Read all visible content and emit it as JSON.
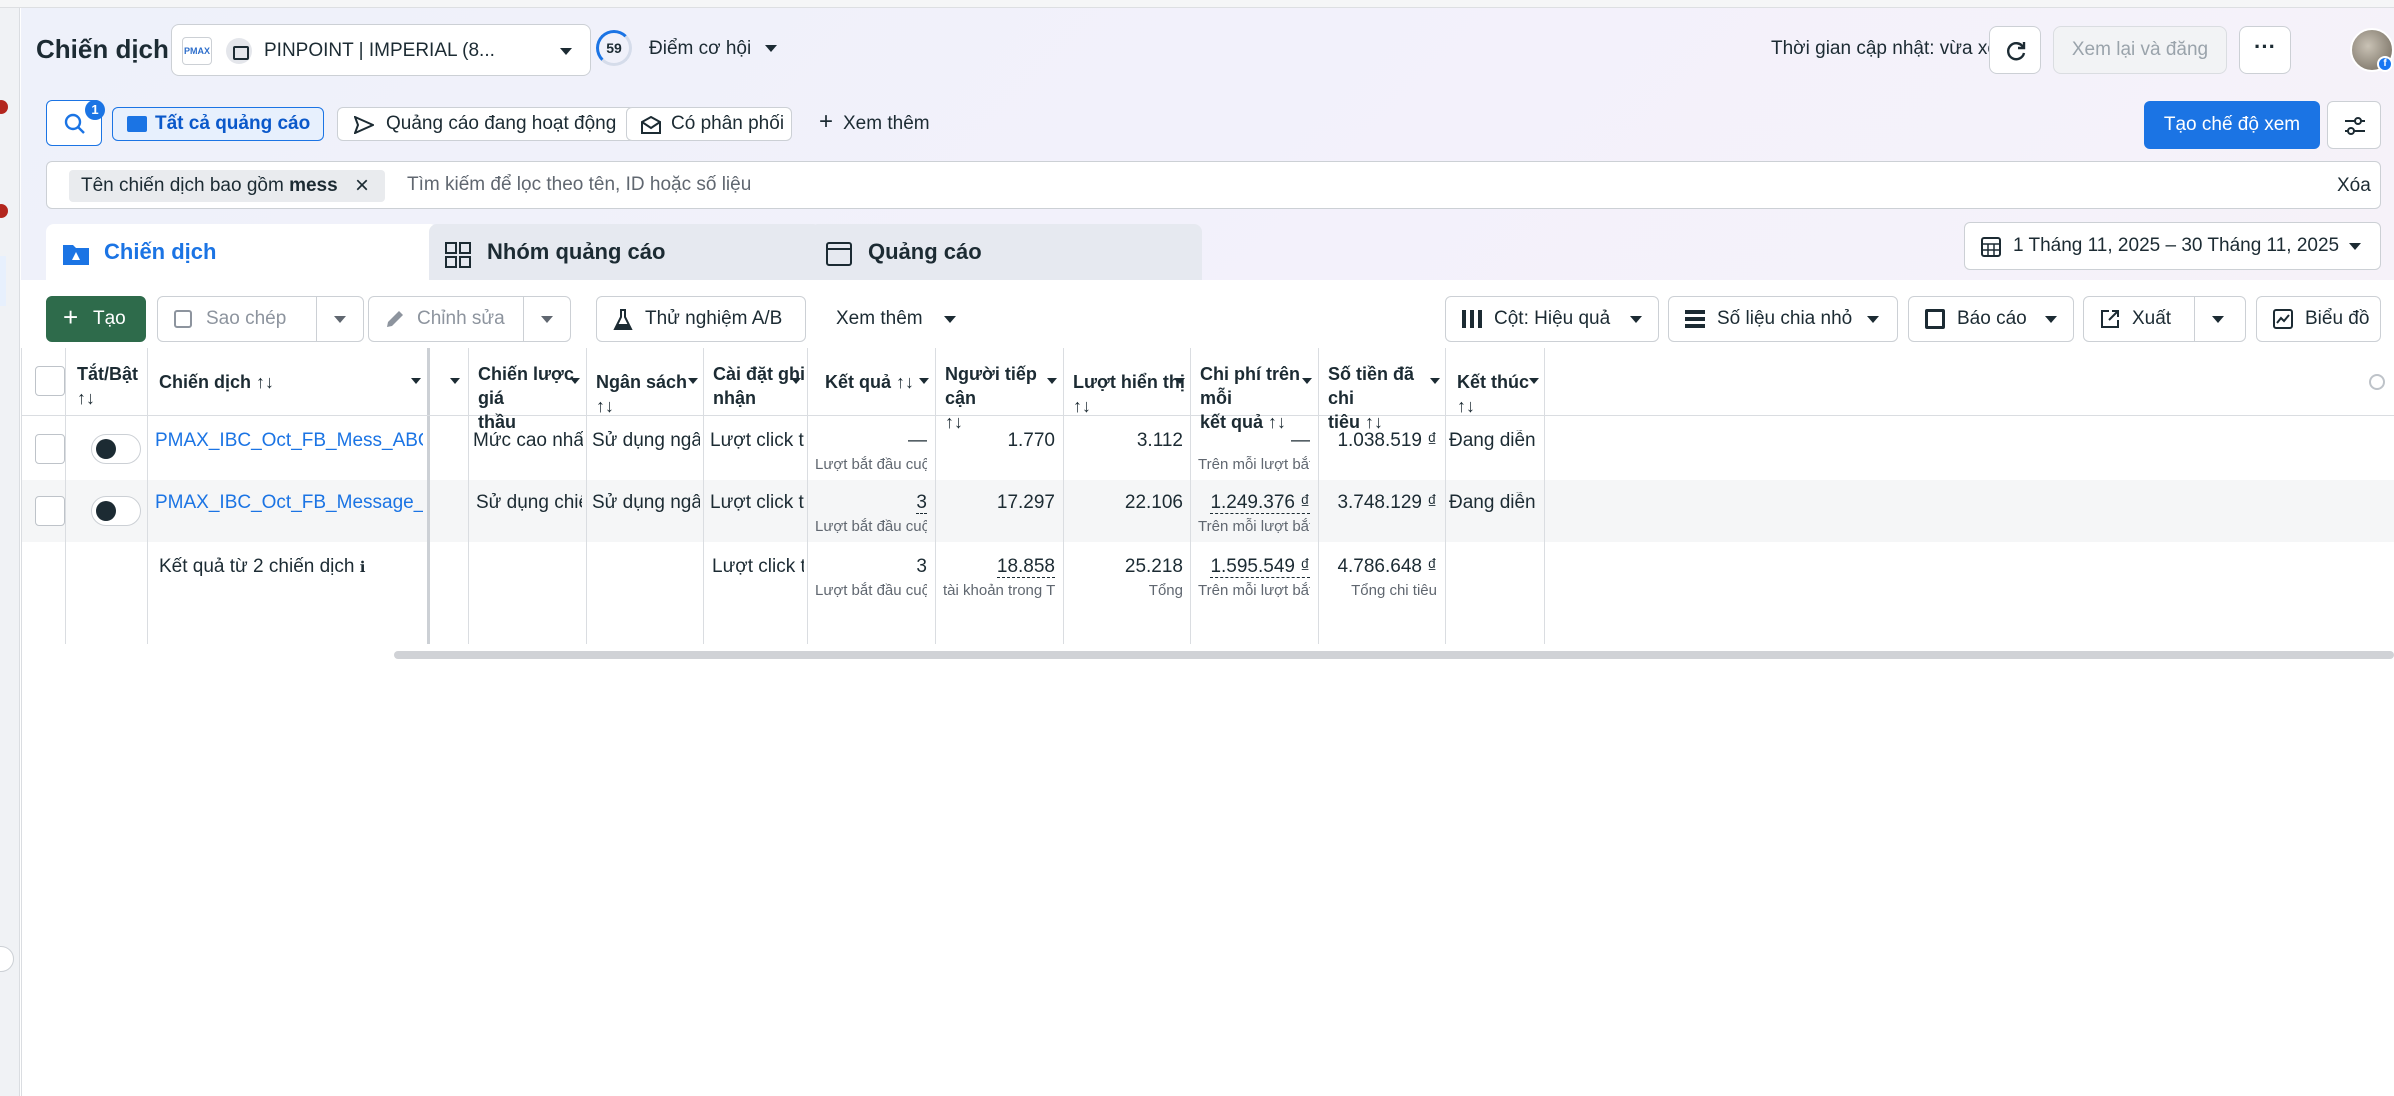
{
  "header": {
    "title": "Chiến dịch",
    "account_logo": "PMAX",
    "account_name": "PINPOINT | IMPERIAL (8...",
    "opportunity_score": "59",
    "opportunity_label": "Điểm cơ hội",
    "update_time": "Thời gian cập nhật: vừa xong",
    "review_publish": "Xem lại và đăng",
    "more": "···"
  },
  "filters": {
    "search_badge": "1",
    "chips": [
      "Tất cả quảng cáo",
      "Quảng cáo đang hoạt động",
      "Có phân phối"
    ],
    "see_more": "Xem thêm",
    "create_view": "Tạo chế độ xem",
    "token_prefix": "Tên chiến dịch bao gồm ",
    "token_value": "mess",
    "search_placeholder": "Tìm kiếm để lọc theo tên, ID hoặc số liệu",
    "clear": "Xóa"
  },
  "level_tabs": [
    "Chiến dịch",
    "Nhóm quảng cáo",
    "Quảng cáo"
  ],
  "date_range": "1 Tháng 11, 2025 – 30 Tháng 11, 2025",
  "toolbar": {
    "create": "Tạo",
    "duplicate": "Sao chép",
    "edit": "Chỉnh sửa",
    "ab_test": "Thử nghiệm A/B",
    "see_more": "Xem thêm",
    "columns": "Cột: Hiệu quả",
    "breakdown": "Số liệu chia nhỏ",
    "reports": "Báo cáo",
    "export": "Xuất",
    "charts": "Biểu đồ"
  },
  "table": {
    "headers": {
      "toggle": [
        "Tắt/Bật",
        "↑↓"
      ],
      "campaign": "Chiến dịch ↑↓",
      "bid_strategy": [
        "Chiến lược giá",
        "thầu"
      ],
      "budget": "Ngân sách ↑↓",
      "attribution": [
        "Cài đặt ghi",
        "nhận"
      ],
      "results": "Kết quả ↑↓",
      "reach": [
        "Người tiếp cận",
        "↑↓"
      ],
      "impressions": "Lượt hiển thị ↑↓",
      "cost_per_result": [
        "Chi phí trên mỗi",
        "kết quả ↑↓"
      ],
      "amount_spent": [
        "Số tiền đã chi",
        "tiêu ↑↓"
      ],
      "ends": "Kết thúc ↑↓"
    },
    "rows": [
      {
        "name": "PMAX_IBC_Oct_FB_Mess_ABO",
        "bid_strategy": "Mức cao nhất",
        "budget": "Sử dụng ngân s...",
        "attribution": "Lượt click tro...",
        "results": "—",
        "results_sub": "Lượt bắt đầu cuộc trò ...",
        "reach": "1.770",
        "impressions": "3.112",
        "cost_per_result": "—",
        "cost_sub": "Trên mỗi lượt bắt đầu ...",
        "amount_spent": "1.038.519 ₫",
        "ends": "Đang diễn ra"
      },
      {
        "name": "PMAX_IBC_Oct_FB_Message_ABO",
        "bid_strategy": "Sử dụng chiến l...",
        "budget": "Sử dụng ngân s...",
        "attribution": "Lượt click tro...",
        "results": "3",
        "results_sub": "Lượt bắt đầu cuộc tr...",
        "reach": "17.297",
        "impressions": "22.106",
        "cost_per_result": "1.249.376 ₫",
        "cost_sub": "Trên mỗi lượt bắt đầu...",
        "amount_spent": "3.748.129 ₫",
        "ends": "Đang diễn ra"
      }
    ],
    "summary": {
      "label": "Kết quả từ 2 chiến dịch",
      "info": "ℹ",
      "attribution": "Lượt click tro...",
      "results": "3",
      "results_sub": "Lượt bắt đầu cuộc tr...",
      "reach": "18.858",
      "reach_sub": "tài khoản trong Trung ...",
      "impressions": "25.218",
      "impressions_sub": "Tổng",
      "cost_per_result": "1.595.549 ₫",
      "cost_sub": "Trên mỗi lượt bắt đầu...",
      "amount_spent": "4.786.648 ₫",
      "amount_sub": "Tổng chi tiêu"
    }
  }
}
